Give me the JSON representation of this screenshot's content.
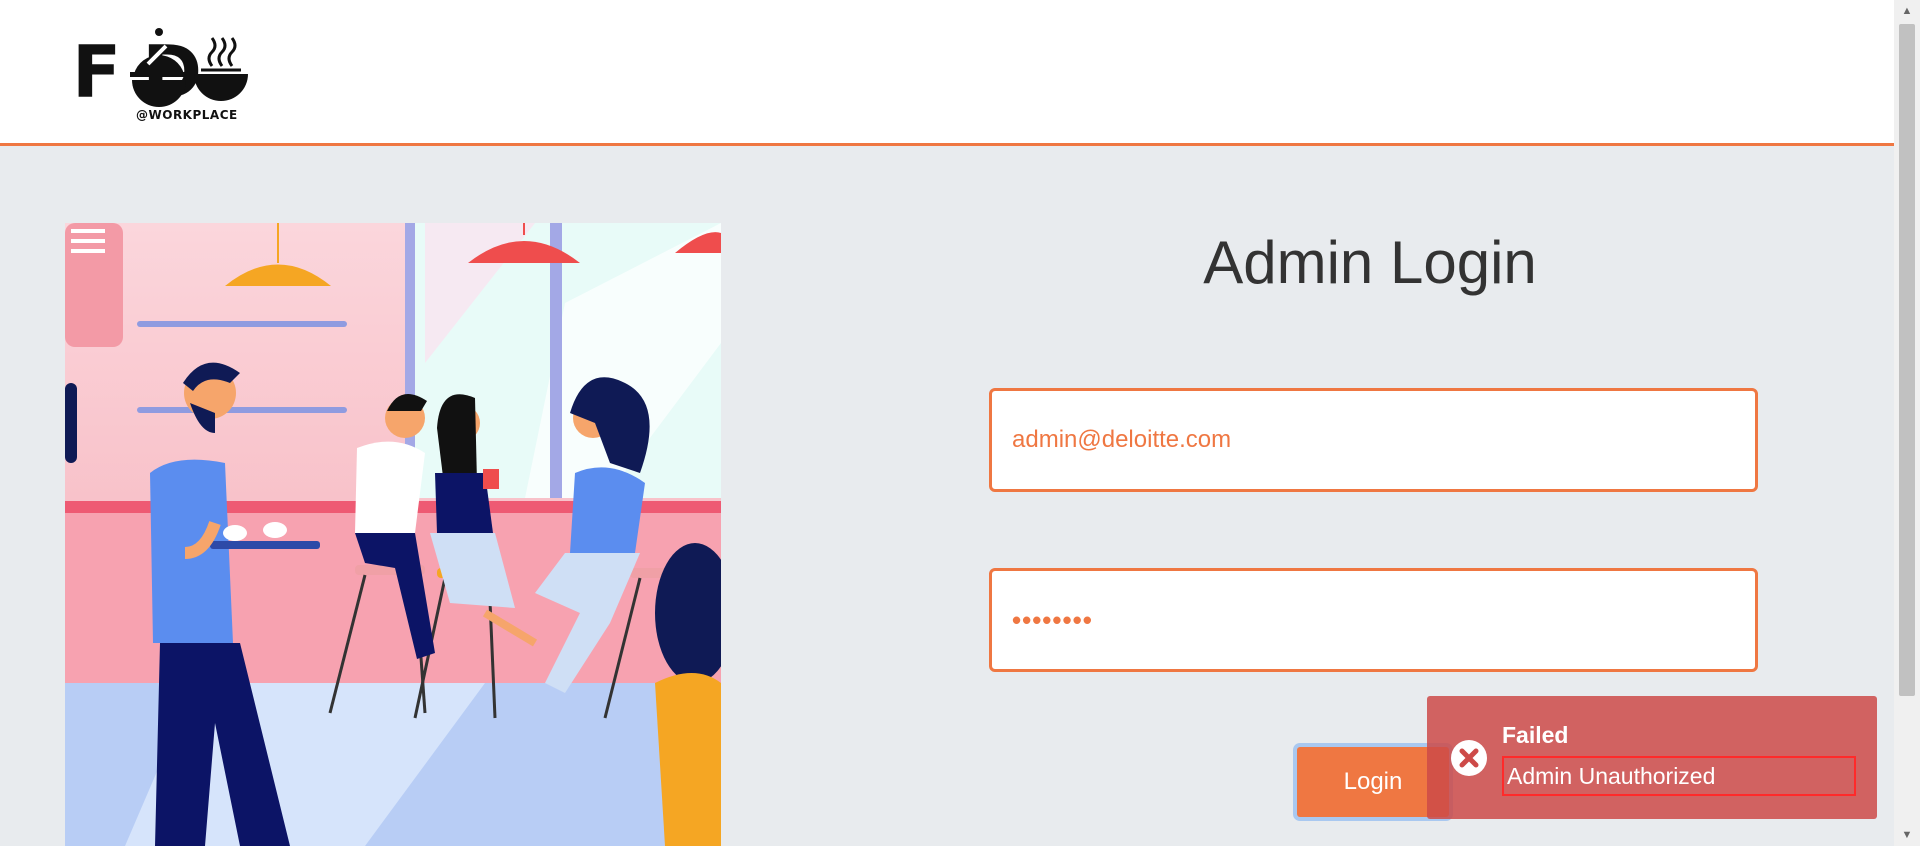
{
  "header": {
    "logo_word": "F    D",
    "logo_sub": "@WORKPLACE"
  },
  "login": {
    "title": "Admin Login",
    "email_value": "admin@deloitte.com",
    "password_value": "••••••••",
    "button_label": "Login"
  },
  "toast": {
    "title": "Failed",
    "message": "Admin Unauthorized"
  },
  "colors": {
    "accent": "#ef7742",
    "background": "#e8ebee",
    "toast": "#cd4a48"
  },
  "icons": {
    "toast_icon": "error-circle-x-icon",
    "scroll_up": "triangle-up-icon",
    "scroll_down": "triangle-down-icon"
  }
}
